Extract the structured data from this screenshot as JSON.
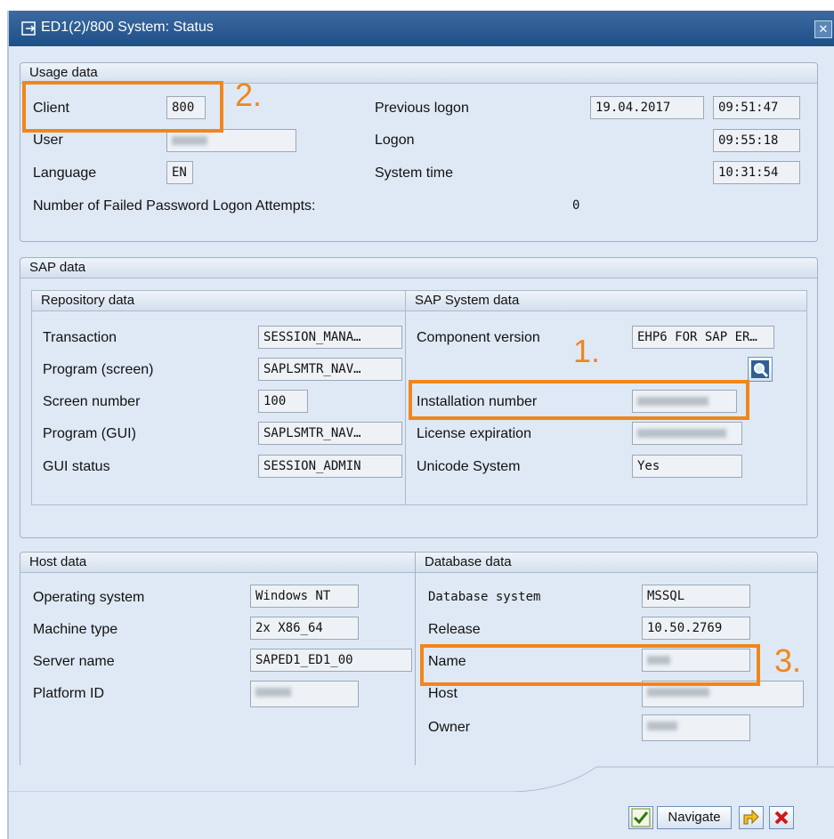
{
  "window": {
    "title": "ED1(2)/800 System: Status",
    "close_label": "✕"
  },
  "usage": {
    "header": "Usage data",
    "client_label": "Client",
    "client_value": "800",
    "user_label": "User",
    "language_label": "Language",
    "language_value": "EN",
    "prev_logon_label": "Previous logon",
    "prev_logon_date": "19.04.2017",
    "prev_logon_time": "09:51:47",
    "logon_label": "Logon",
    "logon_time": "09:55:18",
    "system_time_label": "System time",
    "system_time": "10:31:54",
    "failed_label": "Number of Failed Password Logon Attempts:",
    "failed_value": "0"
  },
  "sap": {
    "header": "SAP data",
    "repo_header": "Repository data",
    "transaction_label": "Transaction",
    "transaction_value": "SESSION_MANA…",
    "program_screen_label": "Program (screen)",
    "program_screen_value": "SAPLSMTR_NAV…",
    "screen_number_label": "Screen number",
    "screen_number_value": "100",
    "program_gui_label": "Program (GUI)",
    "program_gui_value": "SAPLSMTR_NAV…",
    "gui_status_label": "GUI status",
    "gui_status_value": "SESSION_ADMIN",
    "system_header": "SAP System data",
    "component_label": "Component version",
    "component_value": "EHP6 FOR SAP ER…",
    "installation_label": "Installation number",
    "license_label": "License expiration",
    "unicode_label": "Unicode System",
    "unicode_value": "Yes"
  },
  "host": {
    "header": "Host data",
    "os_label": "Operating system",
    "os_value": "Windows NT",
    "machine_label": "Machine type",
    "machine_value": "2x X86_64",
    "server_label": "Server name",
    "server_value": "SAPED1_ED1_00",
    "platform_label": "Platform ID"
  },
  "database": {
    "header": "Database data",
    "system_label": "Database system",
    "system_value": "MSSQL",
    "release_label": "Release",
    "release_value": "10.50.2769",
    "name_label": "Name",
    "host_label": "Host",
    "owner_label": "Owner"
  },
  "annotations": {
    "one": "1.",
    "two": "2.",
    "three": "3."
  },
  "buttons": {
    "navigate": "Navigate"
  },
  "colors": {
    "annotation": "#f0861c",
    "title_bar": "#2c5b93",
    "panel": "#dfe9f5"
  }
}
